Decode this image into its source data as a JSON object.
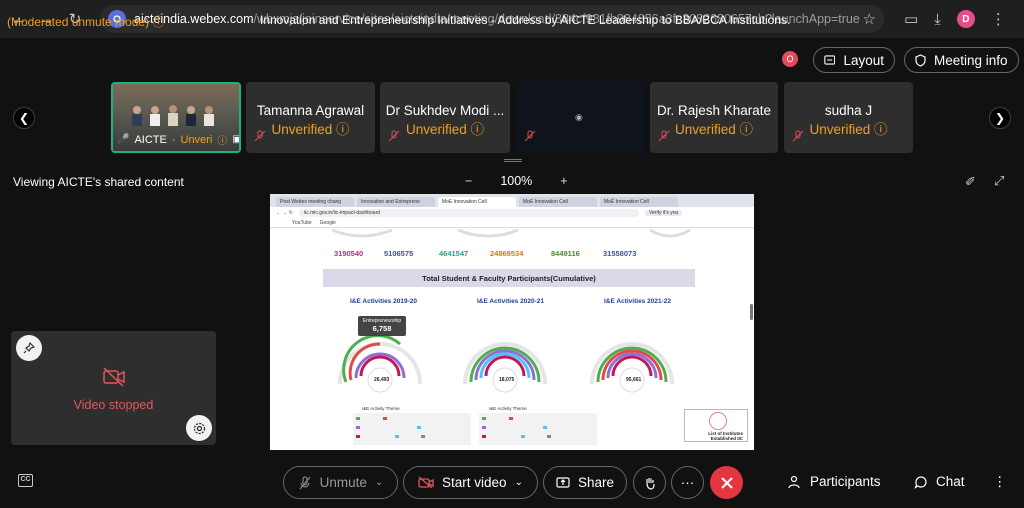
{
  "browser": {
    "url_domain": "aicteindia.webex.com",
    "url_path": "/wbxmjs/joinservice/sites/aicteindia/meeting/download/884cf981fb984856a3fc3082680657cb?launchApp=true",
    "profile_initial": "D"
  },
  "meeting": {
    "mode_label": "(Moderated unmute mode)",
    "title": "Innovation and Entrepreneurship Initiatives - Address by AICTE Leadership to BBA/BCA Institutions.",
    "recording_badge": "O",
    "layout_label": "Layout",
    "info_label": "Meeting info"
  },
  "participants": [
    {
      "name": "AICTE",
      "status": "Unveri"
    },
    {
      "name": "Tamanna Agrawal",
      "status": "Unverified"
    },
    {
      "name": "Dr Sukhdev Modi ...",
      "status": "Unverified"
    },
    {
      "name": "",
      "status": ""
    },
    {
      "name": "Dr. Rajesh Kharate",
      "status": "Unverified"
    },
    {
      "name": "sudha J",
      "status": "Unverified"
    }
  ],
  "share": {
    "viewing_label": "Viewing AICTE's shared content",
    "zoom": "100%",
    "minus": "−",
    "plus": "+",
    "tabs": [
      "Post Webex meeting chang",
      "Innovation and Entreprene",
      "MoE Innovation Cell",
      "MoE Innovation Cell",
      "MoE Innovation Cell"
    ],
    "inner_url": "iic.mic.gov.in/iic-impact-dashboard",
    "bookmarks": [
      "YouTube",
      "Google"
    ],
    "verify_label": "Verify it's you",
    "numbers": [
      {
        "value": "3190540",
        "color": "#b0308e"
      },
      {
        "value": "5106575",
        "color": "#3a4fa8"
      },
      {
        "value": "4641547",
        "color": "#2aa08c"
      },
      {
        "value": "24869534",
        "color": "#c87d1a"
      },
      {
        "value": "8449116",
        "color": "#4a8c2a"
      },
      {
        "value": "31558073",
        "color": "#3a4fa8"
      }
    ],
    "banner": "Total Student & Faculty Participants(Cumulative)",
    "gauge_titles": [
      "I&E Activities 2019-20",
      "I&E Activities 2020-21",
      "I&E Activities 2021-22"
    ],
    "gauge_centers": [
      "26,493",
      "18,075",
      "95,661"
    ],
    "gauge_sublabel": "I&E Activity Theme",
    "tooltip_title": "Entrepreneurship",
    "tooltip_value": "6,758",
    "list_badge": [
      "List of Institutes",
      "Established IIC"
    ]
  },
  "selfview": {
    "status": "Video stopped"
  },
  "controls": {
    "unmute": "Unmute",
    "start_video": "Start video",
    "share": "Share",
    "more": "···",
    "participants": "Participants",
    "chat": "Chat",
    "cc": "CC"
  },
  "colors": {
    "accent_orange": "#f0a020",
    "end_red": "#e3363e",
    "active_tile_border": "#19b38a"
  }
}
